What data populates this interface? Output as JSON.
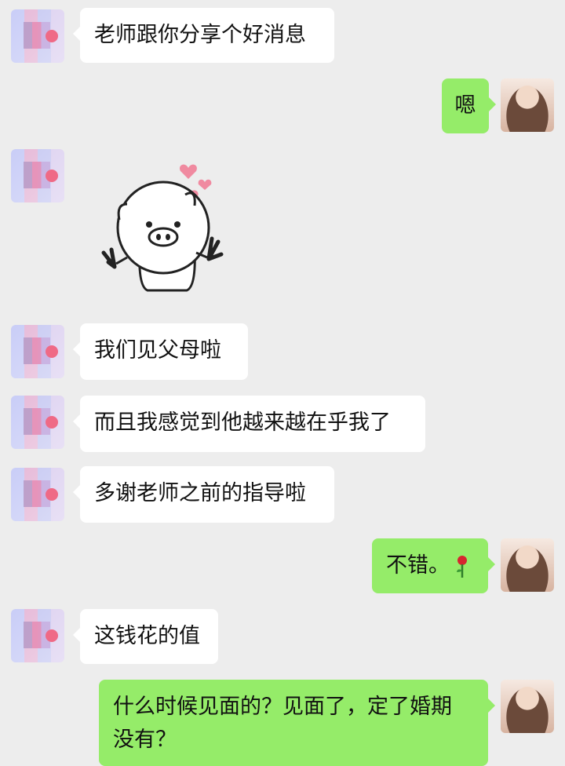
{
  "messages": [
    {
      "side": "left",
      "text": "老师跟你分享个好消息"
    },
    {
      "side": "right",
      "text": "嗯"
    },
    {
      "side": "left",
      "sticker": "pig-waving-hearts-sticker"
    },
    {
      "side": "left",
      "text": "我们见父母啦"
    },
    {
      "side": "left",
      "text": "而且我感觉到他越来越在乎我了"
    },
    {
      "side": "left",
      "text": "多谢老师之前的指导啦"
    },
    {
      "side": "right",
      "text": "不错。",
      "emoji": "rose-icon"
    },
    {
      "side": "left",
      "text": "这钱花的值"
    },
    {
      "side": "right",
      "text_line1": "什么时候见面的？见面了，定了婚期",
      "text_line2": "没有？"
    }
  ],
  "colors": {
    "background": "#ededed",
    "self_bubble": "#95ec69",
    "other_bubble": "#ffffff"
  }
}
